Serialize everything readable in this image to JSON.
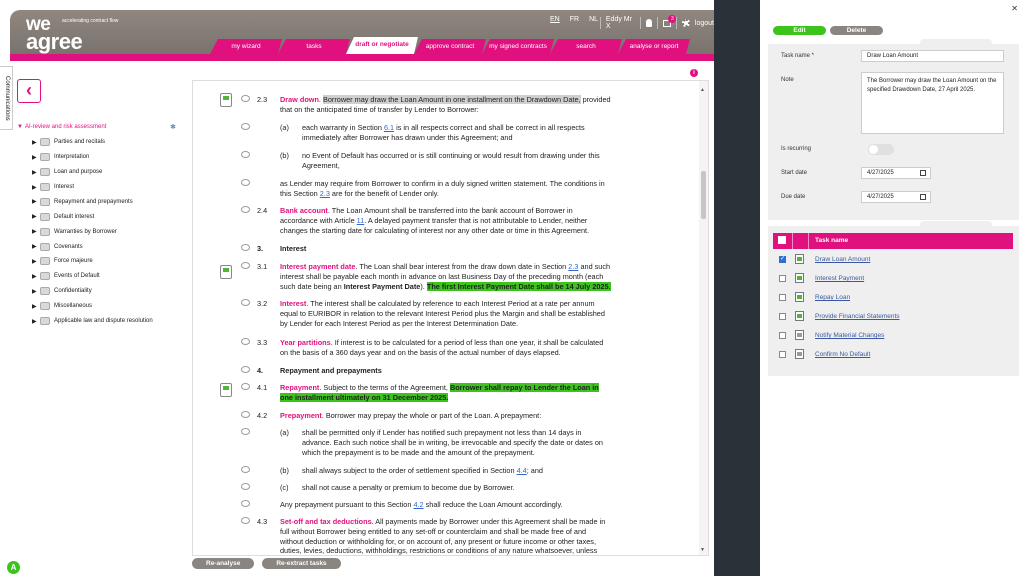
{
  "header": {
    "tagline": "accelerating contract flow",
    "logo_we": "we",
    "logo_agree": "agree",
    "langs": [
      "EN",
      "FR",
      "NL"
    ],
    "user": "Eddy Mr X",
    "mail_count": "3",
    "logout": "logout"
  },
  "tabs": [
    "my wizard",
    "tasks",
    "draft or negotiate",
    "approve contract",
    "my signed contracts",
    "search",
    "analyse or report"
  ],
  "active_tab": "draft or negotiate",
  "communications": "Communications",
  "tree": {
    "root": "AI-review and risk assessment",
    "items": [
      "Parties and recitals",
      "Interpretation",
      "Loan and purpose",
      "Interest",
      "Repayment and prepayments",
      "Default interest",
      "Warranties by Borrower",
      "Covenants",
      "Force majeure",
      "Events of Default",
      "Confidentiality",
      "Miscellaneous",
      "Applicable law and dispute resolution"
    ]
  },
  "doc": {
    "r1_num": "2.3",
    "r1_title": "Draw down",
    "r1_hl": "Borrower may draw the Loan Amount in one installment on the Drawdown Date,",
    "r1_t1": " provided",
    "r1_l2": "that on the anticipated time of transfer by Lender to Borrower:",
    "r2_num": "(a)",
    "r2_t1": "each warranty in Section ",
    "r2_link": "6.1",
    "r2_t2": " is in all respects correct and shall be correct in all respects",
    "r2_l2": "immediately after Borrower has drawn under this Agreement; and",
    "r3_num": "(b)",
    "r3_l1": "no Event of Default has occurred or is still continuing or would result from drawing under this",
    "r3_l2": "Agreement,",
    "r4_l1": "as Lender may require from Borrower to confirm in a duly signed written statement. The conditions in",
    "r4_t1": "this Section ",
    "r4_link": "2.3",
    "r4_t2": " are for the benefit of Lender only.",
    "r5_num": "2.4",
    "r5_title": "Bank account",
    "r5_t1": ". The Loan Amount shall be transferred into the bank account of Borrower in",
    "r5_t2": "accordance with Article ",
    "r5_link": "11",
    "r5_t3": ". A delayed payment transfer that is not attributable to Lender, neither",
    "r5_l3": "changes the starting date for calculating of interest nor any other date or time in this Agreement.",
    "r6_num": "3.",
    "r6_title": "Interest",
    "r7_num": "3.1",
    "r7_title": "Interest payment date",
    "r7_t1": ". The Loan shall bear interest from the draw down date in Section ",
    "r7_link": "2.3",
    "r7_t2": " and such",
    "r7_l2": "interest shall be payable each month in advance on last Business Day of the preceding month (each",
    "r7_t3": "such date being an ",
    "r7_bold": "Interest Payment Date",
    "r7_t4": "). ",
    "r7_hl": "The first Interest Payment Date shall be 14 July 2025.",
    "r8_num": "3.2",
    "r8_title": "Interest",
    "r8_t1": ". The interest shall be calculated by reference to each Interest Period at a rate per annum",
    "r8_l2": "equal to EURIBOR in relation to the relevant Interest Period plus the Margin and shall be established",
    "r8_l3": "by Lender for each Interest Period as per the Interest Determination Date.",
    "r9_num": "3.3",
    "r9_title": "Year partitions",
    "r9_t1": ". If interest is to be calculated for a period of less than one year, it shall be calculated",
    "r9_l2": "on the basis of a 360 days year and on the basis of the actual number of days elapsed.",
    "r10_num": "4.",
    "r10_title": "Repayment and prepayments",
    "r11_num": "4.1",
    "r11_title": "Repayment",
    "r11_t1": ". Subject to the terms of the Agreement, ",
    "r11_hl1": "Borrower shall repay to Lender the Loan in",
    "r11_hl2": "one installment ultimately on 31 December 2025.",
    "r12_num": "4.2",
    "r12_title": "Prepayment",
    "r12_t1": ". Borrower may prepay the whole or part of the Loan. A prepayment:",
    "r13_num": "(a)",
    "r13_l1": "shall be permitted only if Lender has notified such prepayment not less than 14 days in",
    "r13_l2": "advance. Each such notice shall be in writing, be irrevocable and specify the date or dates on",
    "r13_l3": "which the prepayment is to be made and the amount of the prepayment.",
    "r14_num": "(b)",
    "r14_t1": "shall always subject to the order of settlement specified in Section ",
    "r14_link": "4.4",
    "r14_t2": "; and",
    "r15_num": "(c)",
    "r15_l1": "shall not cause a penalty or premium to become due by Borrower.",
    "r16_t1": "Any prepayment pursuant to this Section ",
    "r16_link": "4.2",
    "r16_t2": " shall reduce the Loan Amount accordingly.",
    "r17_num": "4.3",
    "r17_title": "Set-off and tax deductions",
    "r17_t1": ". All payments made by Borrower under this Agreement shall be made in",
    "r17_l2": "full without Borrower being entitled to any set-off or counterclaim and shall be made free of and",
    "r17_l3": "without deduction or withholding for, or on account of, any present or future income or other taxes,",
    "r17_l4": "duties, levies, deductions, withholdings, restrictions or conditions of any nature whatsoever, unless"
  },
  "bottom": {
    "reanalyse": "Re-analyse",
    "reextract": "Re-extract tasks",
    "help": "A"
  },
  "panel": {
    "edit": "Edit",
    "delete": "Delete",
    "task_name_label": "Task name *",
    "task_name": "Draw Loan Amount",
    "note_label": "Note",
    "note": "The Borrower may draw the Loan Amount on the specified Drawdown Date, 27 April 2025.",
    "recurring_label": "Is recurring",
    "start_label": "Start date",
    "start": "4/27/2025",
    "due_label": "Due date",
    "due": "4/27/2025",
    "col_task": "Task name",
    "tasks": [
      {
        "name": "Draw Loan Amount",
        "checked": true
      },
      {
        "name": "Interest Payment",
        "checked": false
      },
      {
        "name": "Repay Loan",
        "checked": false
      },
      {
        "name": "Provide Financial Statements",
        "checked": false
      },
      {
        "name": "Notify Material Changes",
        "checked": false
      },
      {
        "name": "Confirm No Default",
        "checked": false
      }
    ]
  },
  "colors": {
    "brand": "#e0117f",
    "green": "#3cc41c",
    "header": "#7a726c"
  }
}
